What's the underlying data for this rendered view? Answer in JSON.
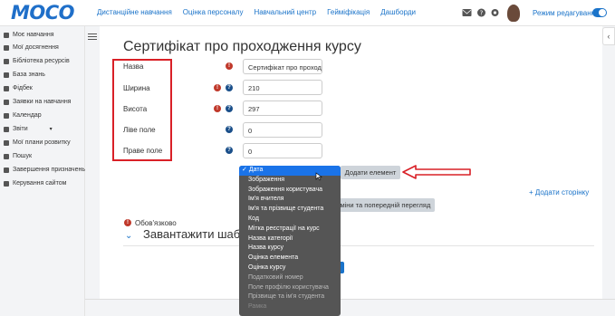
{
  "header": {
    "logo": "MOCO",
    "nav": [
      "Дистанційне навчання",
      "Оцінка персоналу",
      "Навчальний центр",
      "Гейміфікація",
      "Дашборди"
    ],
    "edit_mode_label": "Режим редагування"
  },
  "sidebar": {
    "items": [
      {
        "label": "Моє навчання",
        "icon": "graduation-icon"
      },
      {
        "label": "Мої досягнення",
        "icon": "trophy-icon"
      },
      {
        "label": "Бібліотека ресурсів",
        "icon": "book-icon"
      },
      {
        "label": "База знань",
        "icon": "database-icon"
      },
      {
        "label": "Фідбек",
        "icon": "feedback-icon"
      },
      {
        "label": "Заявки на навчання",
        "icon": "request-icon"
      },
      {
        "label": "Календар",
        "icon": "calendar-icon"
      },
      {
        "label": "Звіти",
        "icon": "chart-icon"
      },
      {
        "label": "Мої плани розвитку",
        "icon": "plan-icon"
      },
      {
        "label": "Пошук",
        "icon": "search-icon"
      },
      {
        "label": "Завершення призначень",
        "icon": "check-icon"
      },
      {
        "label": "Керування сайтом",
        "icon": "wrench-icon"
      }
    ]
  },
  "main": {
    "title": "Сертифікат про проходження курсу",
    "fields": [
      {
        "label": "Назва",
        "value": "Сертифікат про проход",
        "required": true,
        "help": false
      },
      {
        "label": "Ширина",
        "value": "210",
        "required": true,
        "help": true
      },
      {
        "label": "Висота",
        "value": "297",
        "required": true,
        "help": true
      },
      {
        "label": "Ліве поле",
        "value": "0",
        "required": false,
        "help": true
      },
      {
        "label": "Праве поле",
        "value": "0",
        "required": false,
        "help": true
      }
    ],
    "add_element_label": "Додати елемент",
    "add_page_label": "+ Додати сторінку",
    "preview_label": "зміни та попередній перегляд",
    "required_note": "Обов'язково",
    "upload_title": "Завантажити шаблон"
  },
  "dropdown": {
    "items": [
      "Дата",
      "Зображення",
      "Зображення користувача",
      "Ім'я вчителя",
      "Ім'я та прізвище студента",
      "Код",
      "Мітка реєстрації на курс",
      "Назва категорії",
      "Назва курсу",
      "Оцінка елемента",
      "Оцінка курсу",
      "Податковий номер",
      "Поле профілю користувача",
      "Прізвище та ім'я студента",
      "Рамка"
    ],
    "selected": "Дата"
  },
  "colors": {
    "accent": "#1a73c9",
    "annotation": "#d92027",
    "required": "#c0392b"
  }
}
